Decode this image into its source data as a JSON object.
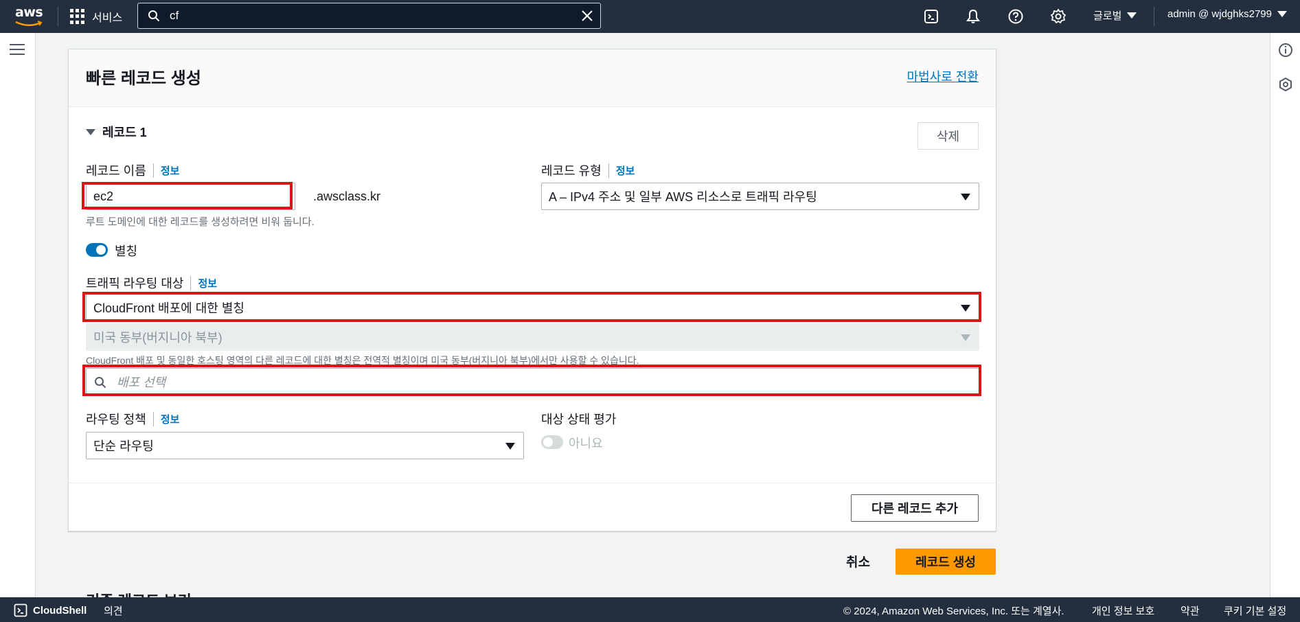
{
  "topbar": {
    "logo": "aws",
    "services_label": "서비스",
    "search_value": "cf",
    "region_label": "글로벌",
    "account_label": "admin @ wjdghks2799"
  },
  "form": {
    "title": "빠른 레코드 생성",
    "wizard_link": "마법사로 전환",
    "record_section": "레코드 1",
    "delete_label": "삭제",
    "record_name_label": "레코드 이름",
    "record_name_value": "ec2",
    "record_name_suffix": ".awsclass.kr",
    "record_name_hint": "루트 도메인에 대한 레코드를 생성하려면 비워 둡니다.",
    "record_type_label": "레코드 유형",
    "record_type_value": "A – IPv4 주소 및 일부 AWS 리소스로 트래픽 라우팅",
    "alias_label": "별칭",
    "alias_enabled": true,
    "route_target_label": "트래픽 라우팅 대상",
    "route_target_value": "CloudFront 배포에 대한 별칭",
    "region_value": "미국 동부(버지니아 북부)",
    "region_hint": "CloudFront 배포 및 동일한 호스팅 영역의 다른 레코드에 대한 별칭은 전역적 별칭이며 미국 동부(버지니아 북부)에서만 사용할 수 있습니다.",
    "distribution_placeholder": "배포 선택",
    "routing_policy_label": "라우팅 정책",
    "routing_policy_value": "단순 라우팅",
    "health_eval_label": "대상 상태 평가",
    "health_eval_value": "아니요",
    "health_eval_enabled": false,
    "info_label": "정보",
    "add_record_label": "다른 레코드 추가",
    "cancel_label": "취소",
    "create_label": "레코드 생성",
    "next_section_label": "기존 레코드 보기"
  },
  "footer": {
    "cloudshell_label": "CloudShell",
    "feedback_label": "의견",
    "copyright": "© 2024, Amazon Web Services, Inc. 또는 계열사.",
    "privacy_label": "개인 정보 보호",
    "terms_label": "약관",
    "cookie_label": "쿠키 기본 설정"
  },
  "colors": {
    "nav_bg": "#232f3e",
    "link": "#0073bb",
    "primary_button": "#ff9900",
    "highlight": "#d91515"
  },
  "icons": [
    "grid-icon",
    "search-icon",
    "close-icon",
    "cloudshell-icon",
    "bell-icon",
    "help-icon",
    "gear-icon",
    "caret-down-icon",
    "menu-icon",
    "info-icon",
    "hexagon-icon"
  ]
}
